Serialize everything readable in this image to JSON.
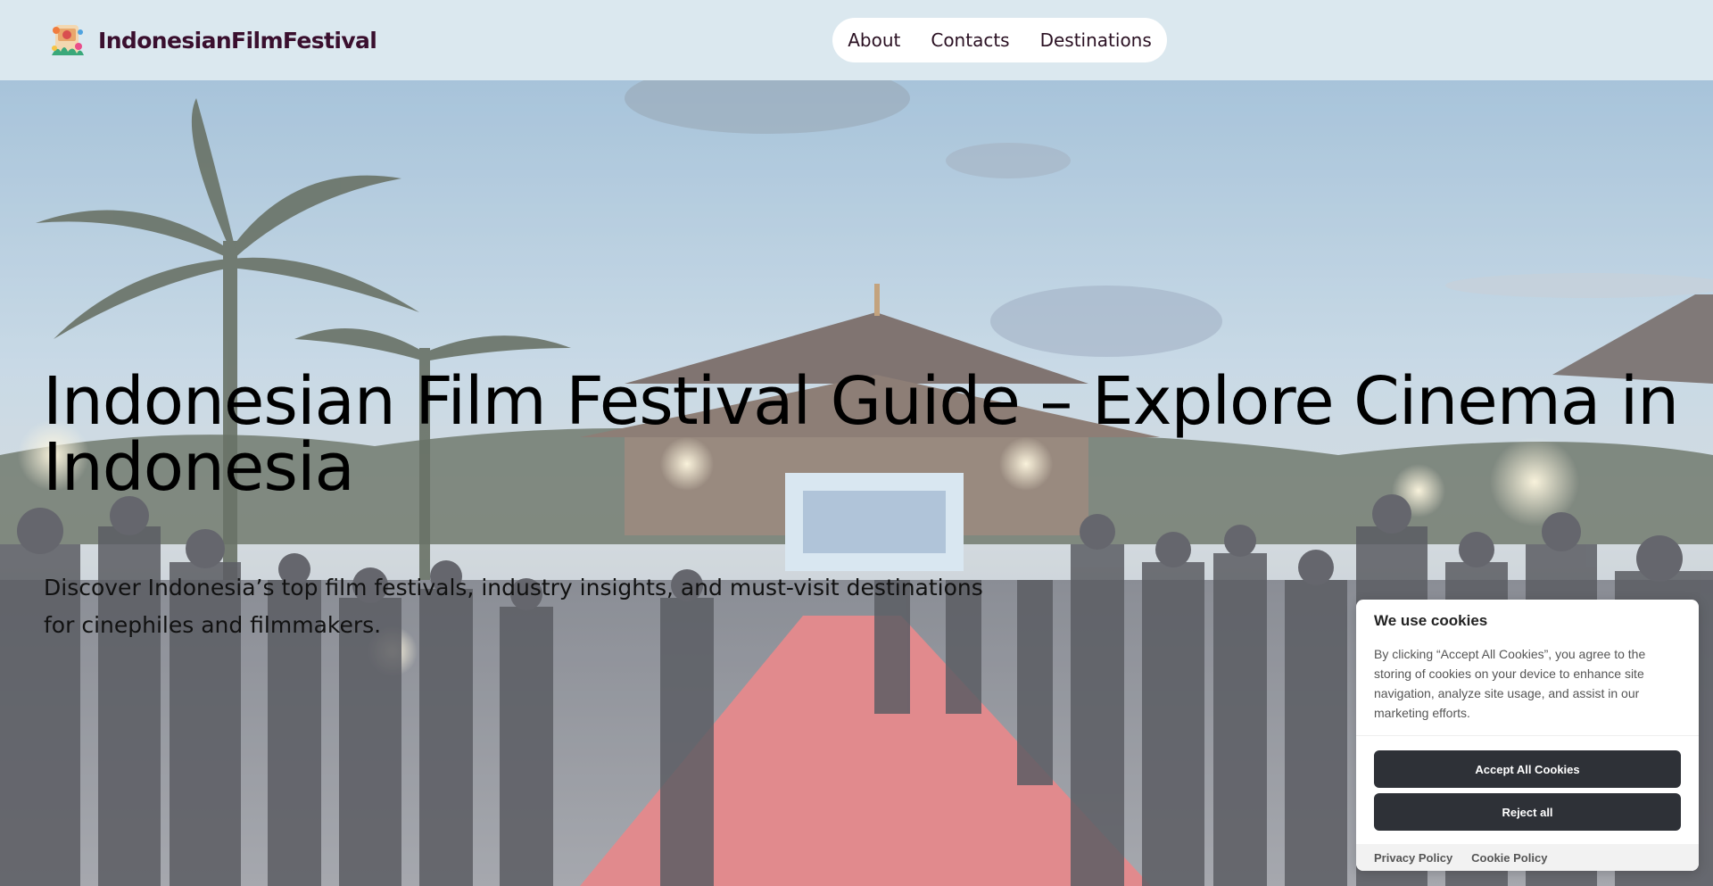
{
  "header": {
    "brand_name": "IndonesianFilmFestival",
    "logo_icon": "festival-illustration-icon",
    "nav": [
      "About",
      "Contacts",
      "Destinations"
    ]
  },
  "hero": {
    "title": "Indonesian Film Festival Guide – Explore Cinema in Indonesia",
    "subtitle": "Discover Indonesia’s top film festivals, industry insights, and must-visit destinations for cinephiles and filmmakers.",
    "background": "festival-red-carpet-photo"
  },
  "cookie_banner": {
    "title": "We use cookies",
    "text": "By clicking “Accept All Cookies”, you agree to the storing of cookies on your device to enhance site navigation, analyze site usage, and assist in our marketing efforts.",
    "accept_label": "Accept All Cookies",
    "reject_label": "Reject all",
    "links": [
      "Privacy Policy",
      "Cookie Policy"
    ]
  },
  "colors": {
    "header_bg": "#dbe8ef",
    "brand_text": "#3a0f2e",
    "button_dark": "#2e3137",
    "carpet": "#d96a6e"
  }
}
